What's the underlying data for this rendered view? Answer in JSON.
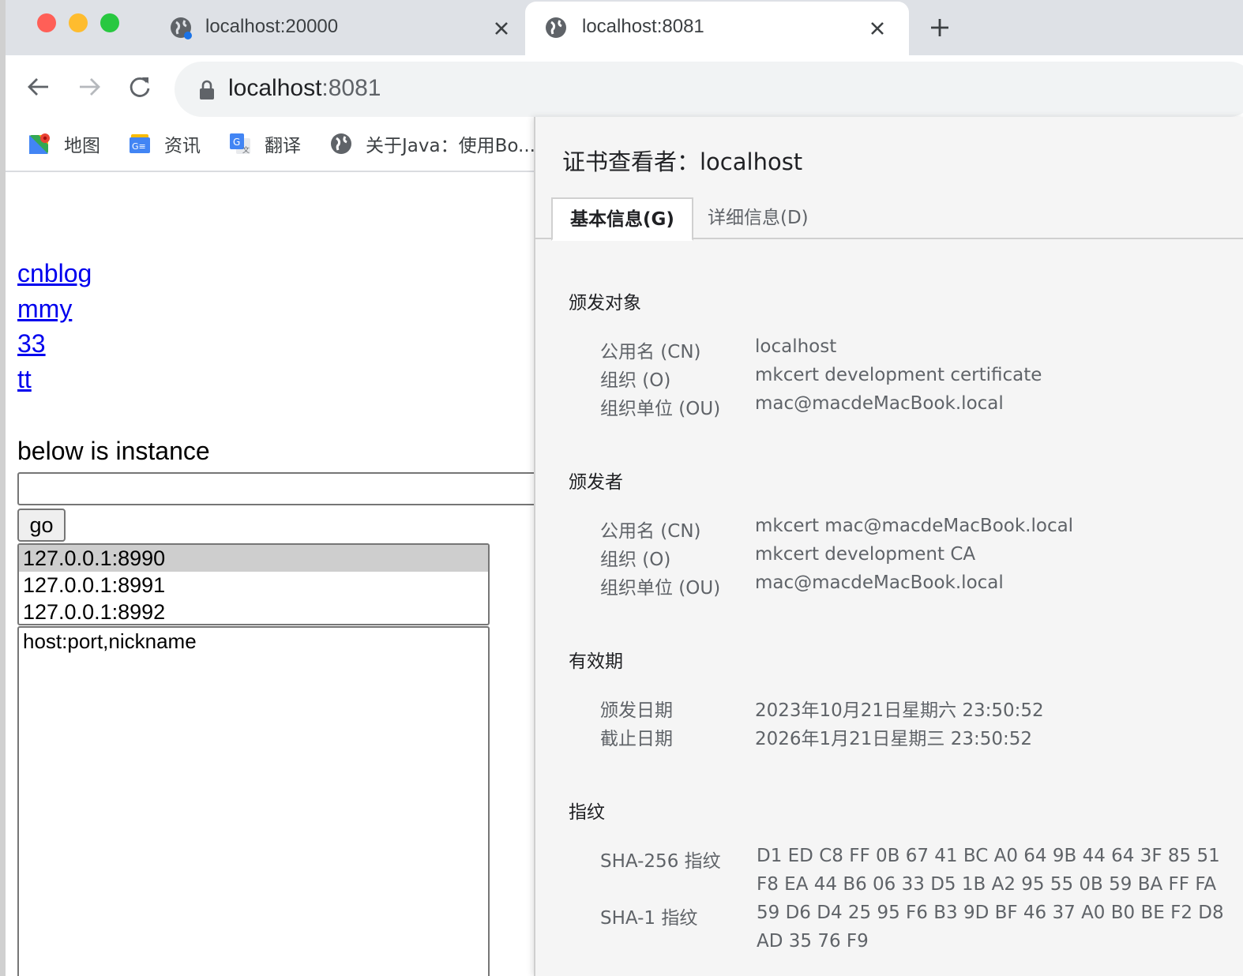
{
  "browser": {
    "tabs": [
      {
        "title": "localhost:20000",
        "active": false
      },
      {
        "title": "localhost:8081",
        "active": true
      }
    ],
    "address_bar": {
      "host": "localhost",
      "port": ":8081"
    },
    "bookmarks": [
      {
        "label": "地图",
        "icon": "maps-icon"
      },
      {
        "label": "资讯",
        "icon": "news-icon"
      },
      {
        "label": "翻译",
        "icon": "translate-icon"
      },
      {
        "label": "关于Java：使用Bo...",
        "icon": "globe-icon"
      }
    ]
  },
  "page": {
    "links": [
      "cnblog",
      "mmy",
      "33",
      "tt"
    ],
    "instance_heading": "below is instance",
    "instance_input_value": "",
    "go_label": "go",
    "server_options": [
      "127.0.0.1:8990",
      "127.0.0.1:8991",
      "127.0.0.1:8992"
    ],
    "selected_server": "127.0.0.1:8990",
    "host_textarea_value": "host:port,nickname"
  },
  "cert_viewer": {
    "title": "证书查看者：localhost",
    "tabs": [
      "基本信息(G)",
      "详细信息(D)"
    ],
    "issued_to": {
      "title": "颁发对象",
      "fields": [
        {
          "label": "公用名 (CN)",
          "value": "localhost"
        },
        {
          "label": "组织 (O)",
          "value": "mkcert development certificate"
        },
        {
          "label": "组织单位 (OU)",
          "value": "mac@macdeMacBook.local"
        }
      ]
    },
    "issued_by": {
      "title": "颁发者",
      "fields": [
        {
          "label": "公用名 (CN)",
          "value": "mkcert mac@macdeMacBook.local"
        },
        {
          "label": "组织 (O)",
          "value": "mkcert development CA"
        },
        {
          "label": "组织单位 (OU)",
          "value": "mac@macdeMacBook.local"
        }
      ]
    },
    "validity": {
      "title": "有效期",
      "fields": [
        {
          "label": "颁发日期",
          "value": "2023年10月21日星期六 23:50:52"
        },
        {
          "label": "截止日期",
          "value": "2026年1月21日星期三 23:50:52"
        }
      ]
    },
    "fingerprints": {
      "title": "指纹",
      "sha256_label": "SHA-256 指纹",
      "sha256_line1": "D1 ED C8 FF 0B 67 41 BC A0 64 9B 44 64 3F 85 51",
      "sha256_line2": "F8 EA 44 B6 06 33 D5 1B A2 95 55 0B 59 BA FF FA",
      "sha1_label": "SHA-1 指纹",
      "sha1_line1": "59 D6 D4 25 95 F6 B3 9D BF 46 37 A0 B0 BE F2 D8",
      "sha1_line2": "AD 35 76 F9"
    }
  },
  "colors": {
    "tabstrip": "#dee1e6",
    "omnibox": "#f1f3f4",
    "link": "#0000ee",
    "dialog_bg": "#f5f5f5",
    "traffic_red": "#ff5f57",
    "traffic_yellow": "#febc2e",
    "traffic_green": "#28c840"
  }
}
